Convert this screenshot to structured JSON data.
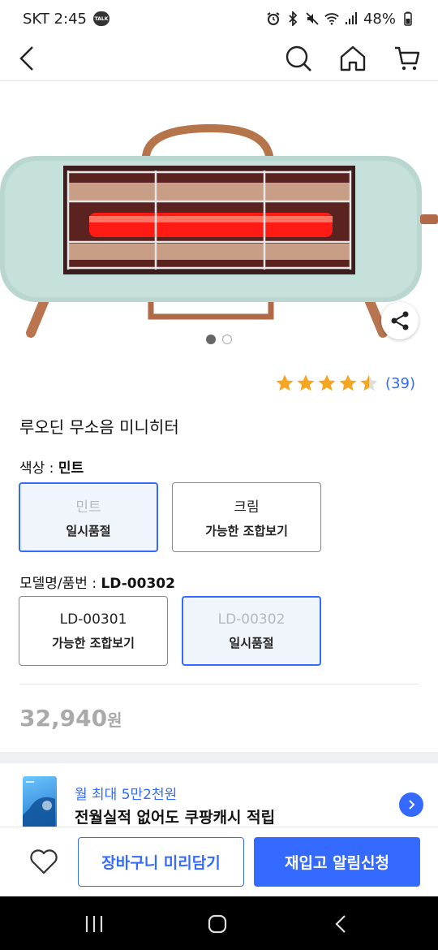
{
  "status_bar": {
    "carrier_time": "SKT 2:45",
    "talk_badge": "TALK",
    "battery": "48%"
  },
  "nav": {
    "icons": [
      "back-icon",
      "search-icon",
      "home-icon",
      "cart-icon"
    ]
  },
  "gallery": {
    "total_images": 2,
    "active_index": 0
  },
  "rating": {
    "stars": 4.5,
    "count": "(39)"
  },
  "product": {
    "title": "루오딘 무소음 미니히터",
    "price": "32,940",
    "currency": "원"
  },
  "color_option": {
    "label": "색상 : ",
    "selected": "민트",
    "choices": [
      {
        "name": "민트",
        "status": "일시품절",
        "selected": true
      },
      {
        "name": "크림",
        "status": "가능한 조합보기",
        "selected": false
      }
    ]
  },
  "model_option": {
    "label": "모델명/품번 : ",
    "selected": "LD-00302",
    "choices": [
      {
        "name": "LD-00301",
        "status": "가능한 조합보기",
        "selected": false
      },
      {
        "name": "LD-00302",
        "status": "일시품절",
        "selected": true
      }
    ]
  },
  "promo": {
    "line1": "월 최대 5만2천원",
    "line2": "전월실적 없어도 쿠팡캐시 적립"
  },
  "actions": {
    "cart_label": "장바구니 미리담기",
    "restock_label": "재입고 알림신청"
  },
  "colors": {
    "accent": "#346aff",
    "selected_bg": "#f0f4fb",
    "star": "#f5a623"
  }
}
